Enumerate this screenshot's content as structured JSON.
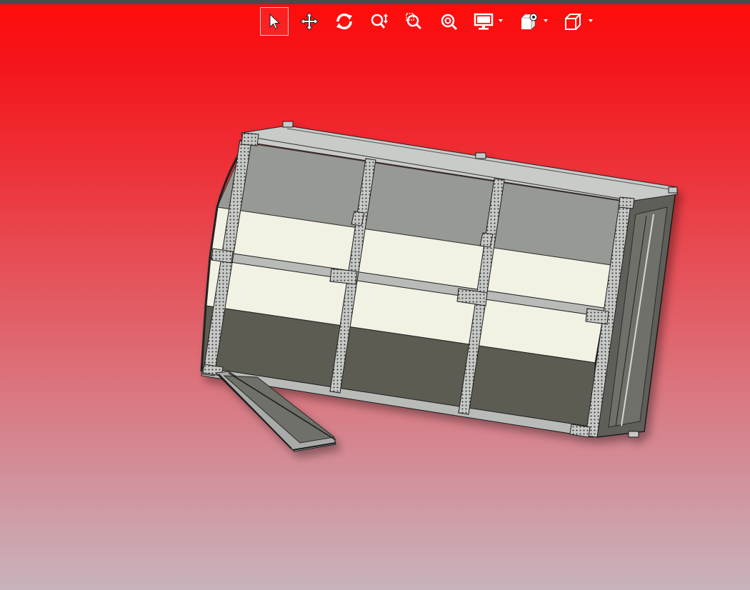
{
  "app": {
    "viewport_background_top": "#ff0c08",
    "viewport_background_bottom": "#c8b3bc"
  },
  "toolbar": {
    "buttons": [
      {
        "id": "select",
        "icon": "select-arrow-icon",
        "active": true
      },
      {
        "id": "pan",
        "icon": "pan-move-icon",
        "active": false
      },
      {
        "id": "rotate",
        "icon": "rotate-icon",
        "active": false
      },
      {
        "id": "zoom-in-out",
        "icon": "zoom-in-out-icon",
        "active": false
      },
      {
        "id": "zoom-to-area",
        "icon": "zoom-to-area-icon",
        "active": false
      },
      {
        "id": "zoom-to-fit",
        "icon": "zoom-to-fit-icon",
        "active": false
      },
      {
        "id": "display-style",
        "icon": "display-style-icon",
        "has_dropdown": true
      },
      {
        "id": "hide-show",
        "icon": "hide-show-items-icon",
        "has_dropdown": true
      },
      {
        "id": "view-orientation",
        "icon": "view-orientation-cube-icon",
        "has_dropdown": true
      }
    ],
    "icon_color": "#ffffff"
  },
  "model": {
    "name_visible": false,
    "panel_colors": {
      "top_band": "#979994",
      "middle_bands": "#f1f1e4",
      "bottom_band": "#5b5c52",
      "frame": "#b9bbb9",
      "frame_dark": "#2b2b2b"
    }
  }
}
